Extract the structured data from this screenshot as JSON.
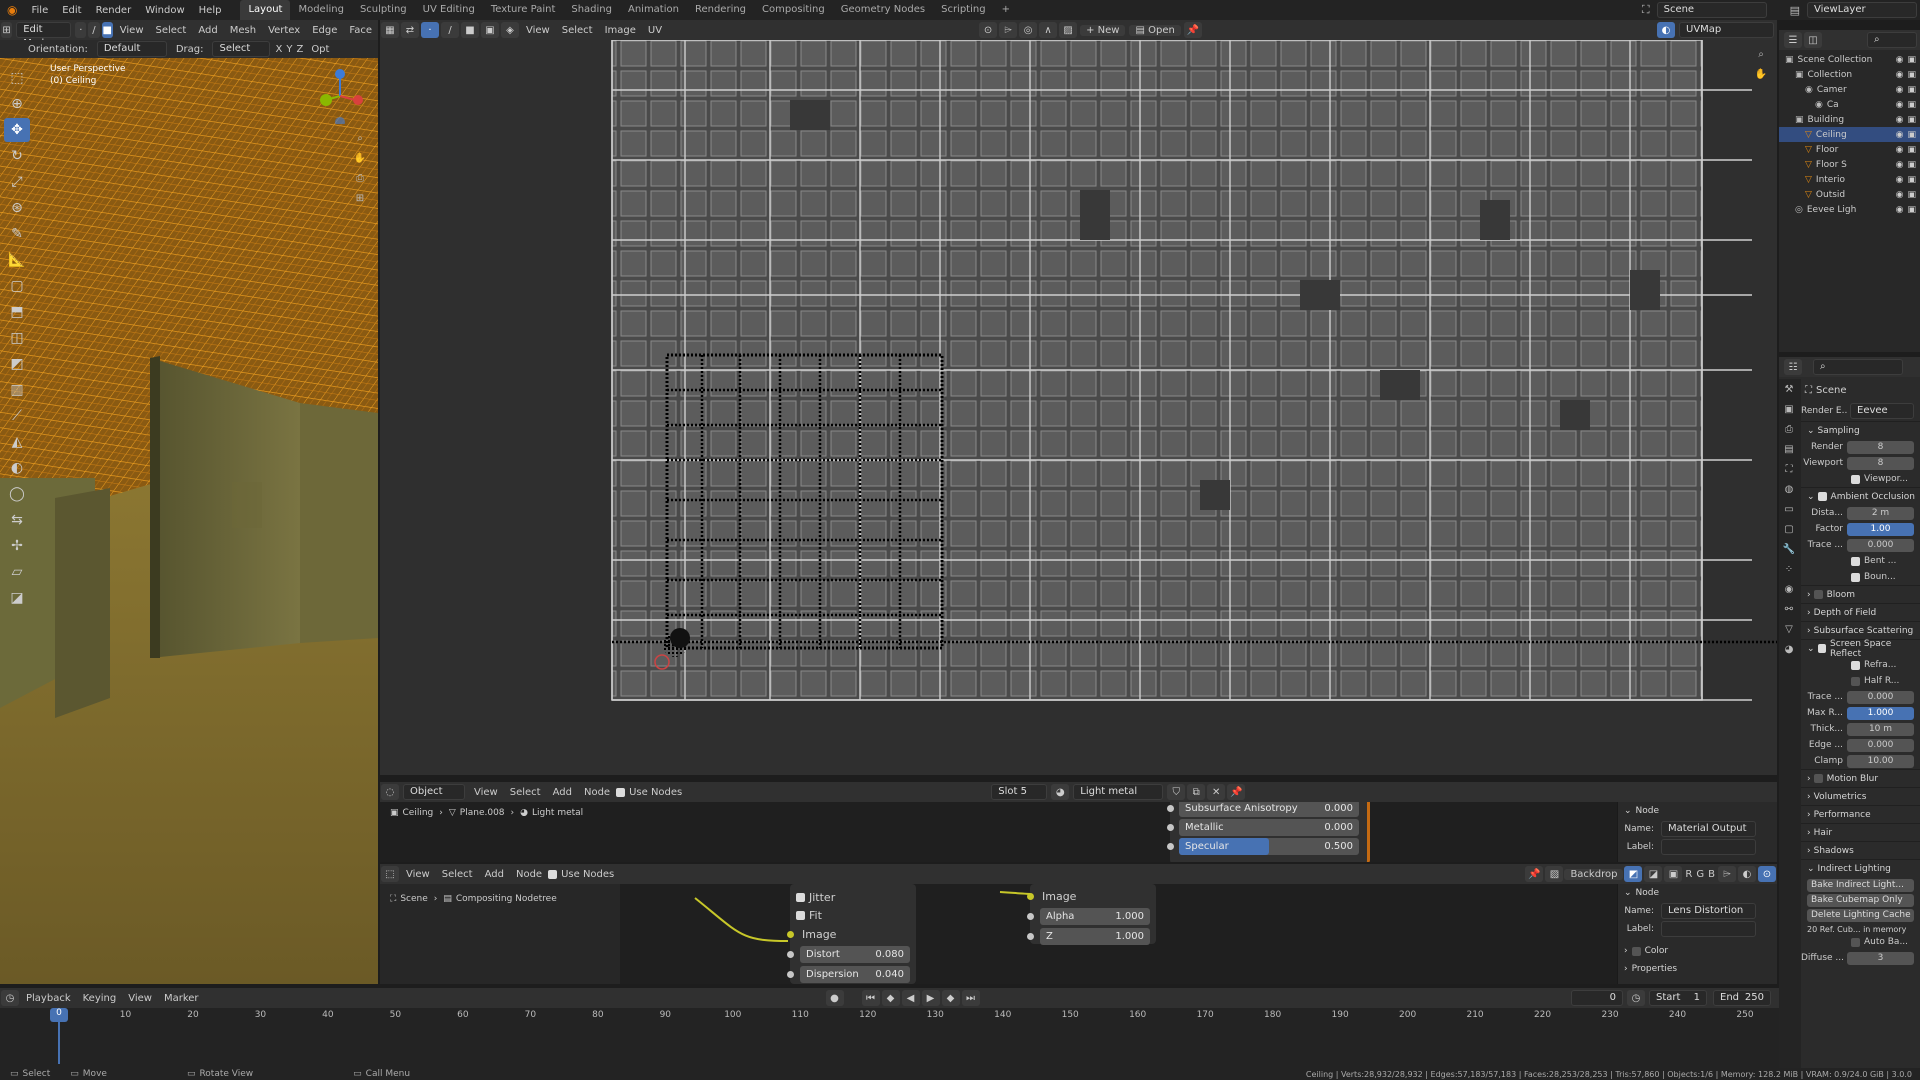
{
  "menu": [
    "File",
    "Edit",
    "Render",
    "Window",
    "Help"
  ],
  "workspaces": [
    "Layout",
    "Modeling",
    "Sculpting",
    "UV Editing",
    "Texture Paint",
    "Shading",
    "Animation",
    "Rendering",
    "Compositing",
    "Geometry Nodes",
    "Scripting"
  ],
  "active_workspace": "Layout",
  "add_workspace": "+",
  "scene": "Scene",
  "view_layer": "ViewLayer",
  "viewport": {
    "mode": "Edit Mode",
    "menus": [
      "View",
      "Select",
      "Add",
      "Mesh",
      "Vertex",
      "Edge",
      "Face"
    ],
    "orientation_label": "Orientation:",
    "orientation": "Default",
    "drag_label": "Drag:",
    "drag": "Select Box",
    "axes": [
      "X",
      "Y",
      "Z"
    ],
    "options": "Opt",
    "overlay_title": "User Perspective",
    "overlay_object": "(0) Ceiling"
  },
  "uv_editor": {
    "menus": [
      "View",
      "Select",
      "Image",
      "UV"
    ],
    "new_label": "New",
    "open_label": "Open",
    "uvmap": "UVMap"
  },
  "shader_editor": {
    "object": "Object",
    "menus": [
      "View",
      "Select",
      "Add",
      "Node"
    ],
    "use_nodes": "Use Nodes",
    "slot": "Slot 5",
    "material": "Light metal",
    "breadcrumb": [
      "Ceiling",
      "Plane.008",
      "Light metal"
    ],
    "fields": [
      {
        "label": "Subsurface Anisotropy",
        "value": "0.000"
      },
      {
        "label": "Metallic",
        "value": "0.000"
      },
      {
        "label": "Specular",
        "value": "0.500"
      }
    ],
    "specular_fill": 0.5,
    "npanel": {
      "section": "Node",
      "name_label": "Name:",
      "name": "Material Output",
      "label_label": "Label:"
    }
  },
  "compositor": {
    "menus": [
      "View",
      "Select",
      "Add",
      "Node"
    ],
    "use_nodes": "Use Nodes",
    "backdrop": "Backdrop",
    "channels": [
      "R",
      "G",
      "B"
    ],
    "breadcrumb": [
      "Scene",
      "Compositing Nodetree"
    ],
    "node1": {
      "jitter": "Jitter",
      "fit": "Fit",
      "image": "Image",
      "distort_label": "Distort",
      "distort": "0.080",
      "dispersion_label": "Dispersion",
      "dispersion": "0.040"
    },
    "node2": {
      "image": "Image",
      "alpha_label": "Alpha",
      "alpha": "1.000",
      "z_label": "Z",
      "z": "1.000"
    },
    "npanel": {
      "section": "Node",
      "name_label": "Name:",
      "name": "Lens Distortion",
      "label_label": "Label:",
      "color": "Color",
      "properties": "Properties"
    }
  },
  "outliner": {
    "rows": [
      {
        "name": "Scene Collection",
        "indent": 0,
        "icon": "▣"
      },
      {
        "name": "Collection",
        "indent": 1,
        "icon": "▣"
      },
      {
        "name": "Camer",
        "indent": 2,
        "icon": "◉"
      },
      {
        "name": "Ca",
        "indent": 3,
        "icon": "◉"
      },
      {
        "name": "Building",
        "indent": 1,
        "icon": "▣"
      },
      {
        "name": "Ceiling",
        "indent": 2,
        "icon": "▽",
        "active": true
      },
      {
        "name": "Floor",
        "indent": 2,
        "icon": "▽"
      },
      {
        "name": "Floor S",
        "indent": 2,
        "icon": "▽"
      },
      {
        "name": "Interio",
        "indent": 2,
        "icon": "▽"
      },
      {
        "name": "Outsid",
        "indent": 2,
        "icon": "▽"
      },
      {
        "name": "Eevee Ligh",
        "indent": 1,
        "icon": "◎"
      }
    ]
  },
  "properties": {
    "scene": "Scene",
    "render_engine_label": "Render E...",
    "render_engine": "Eevee",
    "sampling": "Sampling",
    "render_label": "Render",
    "render": "8",
    "viewport_label": "Viewport",
    "viewport": "8",
    "viewport_denoise": "Viewpor...",
    "ao": "Ambient Occlusion",
    "ao_distance_label": "Dista...",
    "ao_distance": "2 m",
    "ao_factor_label": "Factor",
    "ao_factor": "1.00",
    "ao_trace_label": "Trace ...",
    "ao_trace": "0.000",
    "bent": "Bent ...",
    "bounce": "Boun...",
    "bloom": "Bloom",
    "dof": "Depth of Field",
    "sss": "Subsurface Scattering",
    "ssr": "Screen Space Reflect",
    "refraction": "Refra...",
    "half_res": "Half R...",
    "ssr_trace_label": "Trace ...",
    "ssr_trace": "0.000",
    "max_r_label": "Max R...",
    "max_r": "1.000",
    "thick_label": "Thick...",
    "thick": "10 m",
    "edge_label": "Edge ...",
    "edge": "0.000",
    "clamp_label": "Clamp",
    "clamp": "10.00",
    "motion_blur": "Motion Blur",
    "volumetrics": "Volumetrics",
    "performance": "Performance",
    "hair": "Hair",
    "shadows": "Shadows",
    "indirect": "Indirect Lighting",
    "bake_indirect": "Bake Indirect Light...",
    "bake_cubemap": "Bake Cubemap Only",
    "delete_cache": "Delete Lighting Cache",
    "cache_info": "20 Ref. Cub... in memory",
    "auto_bake": "Auto Ba...",
    "diffuse_label": "Diffuse ...",
    "diffuse": "3"
  },
  "timeline": {
    "menus": [
      "Playback",
      "Keying",
      "View",
      "Marker"
    ],
    "current_frame": "0",
    "start_label": "Start",
    "start": "1",
    "end_label": "End",
    "end": "250",
    "ticks": [
      "0",
      "10",
      "20",
      "30",
      "40",
      "50",
      "60",
      "70",
      "80",
      "90",
      "100",
      "110",
      "120",
      "130",
      "140",
      "150",
      "160",
      "170",
      "180",
      "190",
      "200",
      "210",
      "220",
      "230",
      "240",
      "250"
    ]
  },
  "statusbar": {
    "select": "Select",
    "move": "Move",
    "rotate": "Rotate View",
    "call_menu": "Call Menu",
    "stats": "Ceiling | Verts:28,932/28,932 | Edges:57,183/57,183 | Faces:28,253/28,253 | Tris:57,860 | Objects:1/6 | Memory: 128.2 MiB | VRAM: 0.9/24.0 GiB | 3.0.0"
  },
  "colors": {
    "accent": "#4772b3",
    "wire": "#e08a12",
    "selected": "#f0a020"
  }
}
